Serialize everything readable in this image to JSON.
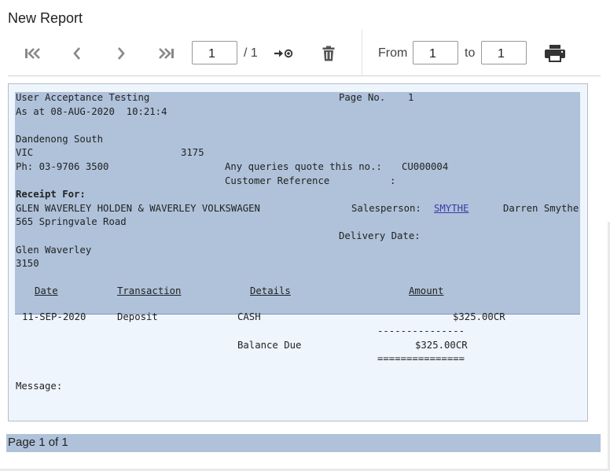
{
  "window": {
    "title": "New Report"
  },
  "toolbar": {
    "buttons": {
      "first": "first-page-icon",
      "prev": "previous-page-icon",
      "next": "next-page-icon",
      "last": "last-page-icon",
      "goto": "go-to-page-icon",
      "delete": "trash-icon",
      "print": "printer-icon"
    },
    "page_value": "1",
    "page_total": "/ 1",
    "from_label": "From",
    "from_value": "1",
    "to_label": "to",
    "to_value": "1"
  },
  "report": {
    "company_name": "User Acceptance Testing",
    "page_no_label": "Page No.",
    "page_no_value": "1",
    "as_at": "As at 08-AUG-2020  10:21:4",
    "suburb": "Dandenong South",
    "state": "VIC",
    "postcode": "3175",
    "phone": "Ph: 03-9706 3500",
    "queries_label": "Any queries quote this no.:",
    "queries_value": "CU000004",
    "customer_ref_label": "Customer Reference",
    "customer_ref_sep": ":",
    "receipt_for_label": "Receipt For:",
    "customer_name": "GLEN WAVERLEY HOLDEN & WAVERLEY VOLKSWAGEN",
    "salesperson_label": "Salesperson:",
    "salesperson_code": "SMYTHE",
    "salesperson_name": "Darren Smythe",
    "address_line1": "565 Springvale Road",
    "delivery_date_label": "Delivery Date:",
    "address_city": "Glen Waverley",
    "address_postcode": "3150",
    "columns": {
      "date": "Date",
      "transaction": "Transaction",
      "details": "Details",
      "amount": "Amount"
    },
    "rows": [
      {
        "date": "11-SEP-2020",
        "transaction": "Deposit",
        "details": "CASH",
        "amount": "$325.00CR"
      }
    ],
    "subtotal_rule": "---------------",
    "balance_label": "Balance Due",
    "balance_value": "$325.00CR",
    "total_rule": "===============",
    "message_label": "Message:"
  },
  "footer": {
    "page_info": "Page 1 of 1"
  },
  "colors": {
    "highlight": "#afc2da",
    "report_background": "#eef5fd",
    "link": "#3b3ba5"
  }
}
